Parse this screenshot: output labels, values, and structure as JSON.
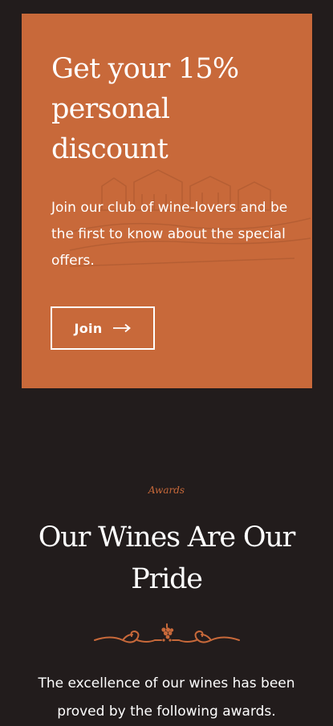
{
  "promo": {
    "title": "Get your 15% personal discount",
    "text": "Join our club of wine-lovers and be the first to know about the special offers.",
    "button_label": "Join",
    "button_icon": "arrow-right-icon",
    "background_color": "#c8693a"
  },
  "awards": {
    "eyebrow": "Awards",
    "title": "Our Wines Are Our Pride",
    "divider_icon": "grape-ornament-icon",
    "text": "The excellence of our wines has been proved by the following awards.",
    "accent_color": "#c8693a"
  },
  "page": {
    "background_color": "#221c1c"
  }
}
